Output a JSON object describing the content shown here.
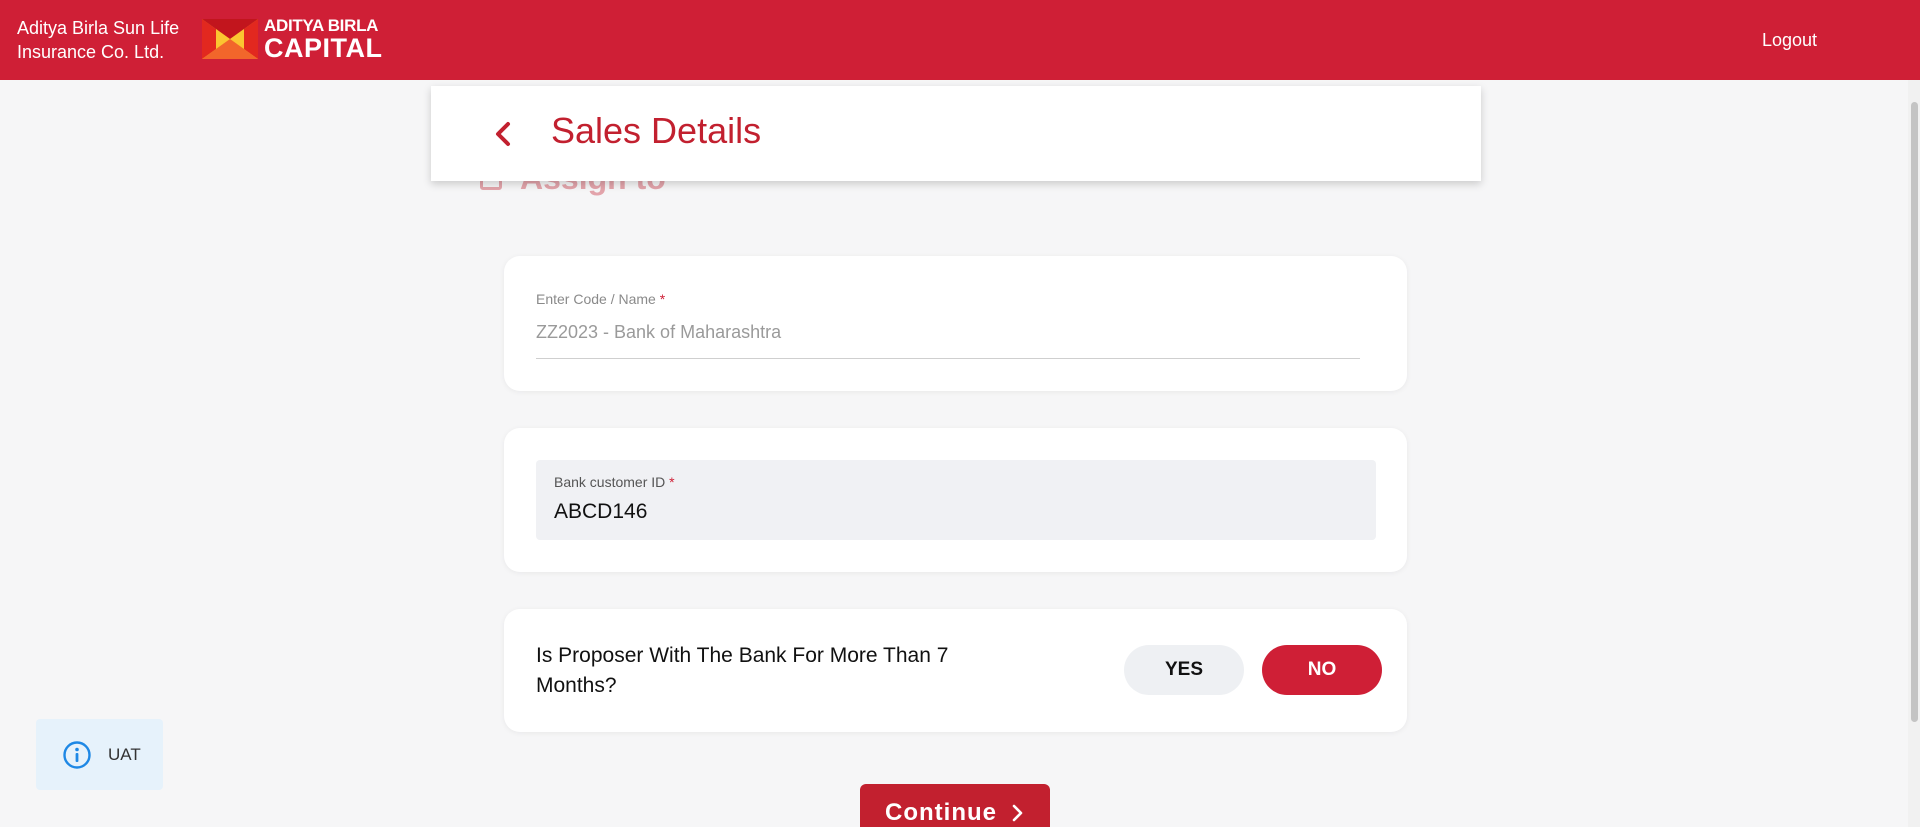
{
  "header": {
    "brand_line1": "Aditya Birla Sun Life",
    "brand_line2": "Insurance Co. Ltd.",
    "logo_line1": "ADITYA BIRLA",
    "logo_line2": "CAPITAL",
    "logout_label": "Logout",
    "brand_color": "#cf1f36"
  },
  "page": {
    "title": "Sales Details",
    "back_icon": "chevron-left-icon",
    "ghost_heading": "Assign to"
  },
  "code_field": {
    "label": "Enter Code / Name",
    "required_mark": "*",
    "value": "ZZ2023 - Bank of Maharashtra"
  },
  "bank_field": {
    "label": "Bank customer ID",
    "required_mark": "*",
    "value": "ABCD146"
  },
  "proposer_question": {
    "text": "Is Proposer With The Bank For More Than 7 Months?",
    "yes_label": "YES",
    "no_label": "NO",
    "selected": "NO"
  },
  "continue_label": "Continue",
  "env_badge": {
    "label": "UAT",
    "icon": "info-icon"
  }
}
